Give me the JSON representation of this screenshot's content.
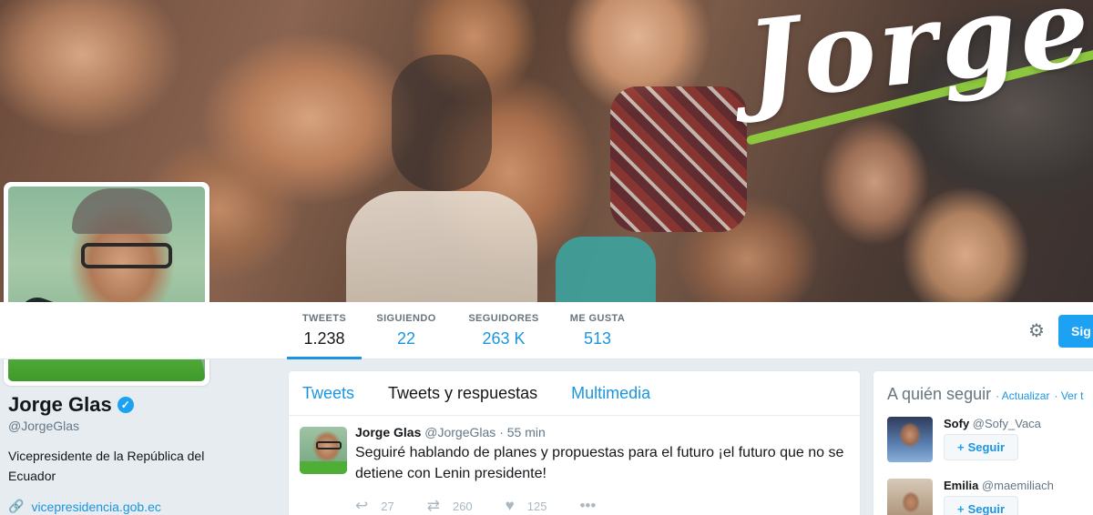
{
  "banner": {
    "script_text": "Jorge"
  },
  "stats": [
    {
      "label": "TWEETS",
      "value": "1.238"
    },
    {
      "label": "SIGUIENDO",
      "value": "22"
    },
    {
      "label": "SEGUIDORES",
      "value": "263 K"
    },
    {
      "label": "ME GUSTA",
      "value": "513"
    }
  ],
  "follow_button": {
    "label": "Sig"
  },
  "profile": {
    "name": "Jorge Glas",
    "handle": "@JorgeGlas",
    "bio": "Vicepresidente de la República del Ecuador",
    "link": "vicepresidencia.gob.ec"
  },
  "timeline": {
    "tabs": [
      "Tweets",
      "Tweets y respuestas",
      "Multimedia"
    ],
    "tweet": {
      "name": "Jorge Glas",
      "handle": "@JorgeGlas",
      "separator": "·",
      "time": "55 min",
      "text": "Seguiré hablando de planes y propuestas para el futuro ¡el futuro que no se detiene con Lenin presidente!",
      "replies": "27",
      "retweets": "260",
      "likes": "125"
    }
  },
  "who_to_follow": {
    "title": "A quién seguir",
    "refresh": "· Actualizar",
    "view_all": "· Ver t",
    "suggestions": [
      {
        "name": "Sofy",
        "handle": "@Sofy_Vaca",
        "button": "Seguir"
      },
      {
        "name": "Emilia",
        "handle": "@maemiliach",
        "button": "Seguir"
      }
    ]
  }
}
